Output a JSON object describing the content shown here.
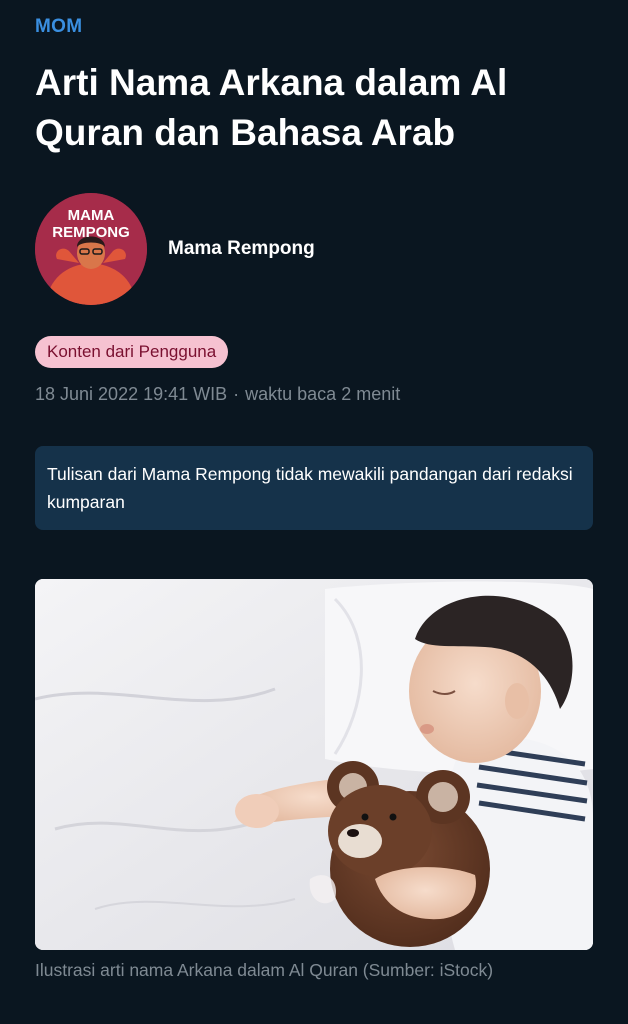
{
  "article": {
    "category": "MOM",
    "title": "Arti Nama Arkana dalam Al Quran dan Bahasa Arab",
    "author": {
      "name": "Mama Rempong",
      "avatar_text_line1": "MAMA",
      "avatar_text_line2": "REMPONG"
    },
    "badge": "Konten dari Pengguna",
    "date": "18 Juni 2022 19:41 WIB",
    "separator": "·",
    "read_time": "waktu baca 2 menit",
    "disclaimer": "Tulisan dari Mama Rempong tidak mewakili pandangan dari redaksi kumparan",
    "image_caption": "Ilustrasi arti nama Arkana dalam Al Quran (Sumber: iStock)"
  },
  "colors": {
    "background": "#0a1620",
    "category": "#3a8fe0",
    "badge_bg": "#f6c2d1",
    "badge_text": "#7a1030",
    "notice_bg": "#15324a",
    "muted_text": "#7f8a93"
  }
}
